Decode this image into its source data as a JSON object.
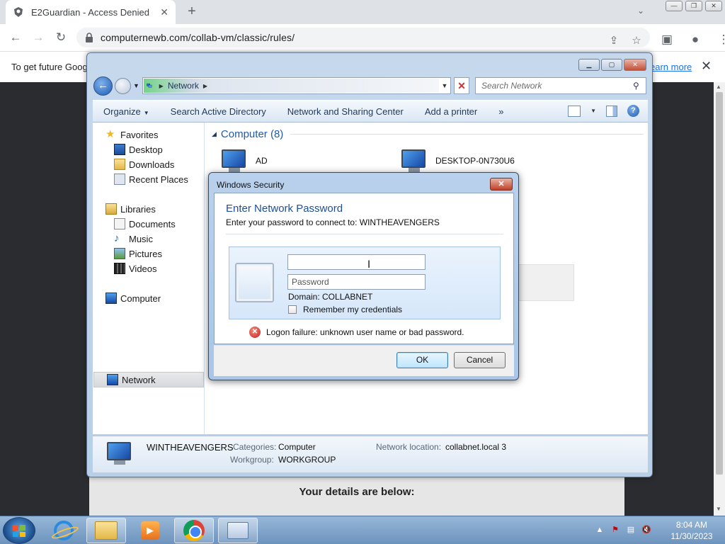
{
  "browser": {
    "tab_title": "E2Guardian - Access Denied",
    "url": "computernewb.com/collab-vm/classic/rules/",
    "infobar_text": "To get future Goog",
    "infobar_link": "earn more"
  },
  "page": {
    "details_heading": "Your details are below:"
  },
  "explorer": {
    "breadcrumb": "Network",
    "search_placeholder": "Search Network",
    "commands": [
      "Organize",
      "Search Active Directory",
      "Network and Sharing Center",
      "Add a printer"
    ],
    "more_glyph": "»",
    "nav": {
      "favorites": "Favorites",
      "desktop": "Desktop",
      "downloads": "Downloads",
      "recent": "Recent Places",
      "libraries": "Libraries",
      "documents": "Documents",
      "music": "Music",
      "pictures": "Pictures",
      "videos": "Videos",
      "computer": "Computer",
      "network": "Network"
    },
    "group_title": "Computer (8)",
    "computers": [
      "AD",
      "DESKTOP-0N730U6"
    ],
    "details": {
      "name": "WINTHEAVENGERS",
      "categories_label": "Categories:",
      "categories_value": "Computer",
      "workgroup_label": "Workgroup:",
      "workgroup_value": "WORKGROUP",
      "netloc_label": "Network location:",
      "netloc_value": "collabnet.local 3"
    }
  },
  "dialog": {
    "title": "Windows Security",
    "heading": "Enter Network Password",
    "subtitle": "Enter your password to connect to: WINTHEAVENGERS",
    "username_value": "",
    "password_placeholder": "Password",
    "domain": "Domain: COLLABNET",
    "remember_label": "Remember my credentials",
    "remember_checked": false,
    "error": "Logon failure: unknown user name or bad password.",
    "ok": "OK",
    "cancel": "Cancel"
  },
  "taskbar": {
    "time": "8:04 AM",
    "date": "11/30/2023"
  },
  "icons": {
    "tab_favicon": "e2guardian-icon",
    "lock": "lock-icon",
    "error": "error-icon",
    "computer": "computer-icon"
  }
}
